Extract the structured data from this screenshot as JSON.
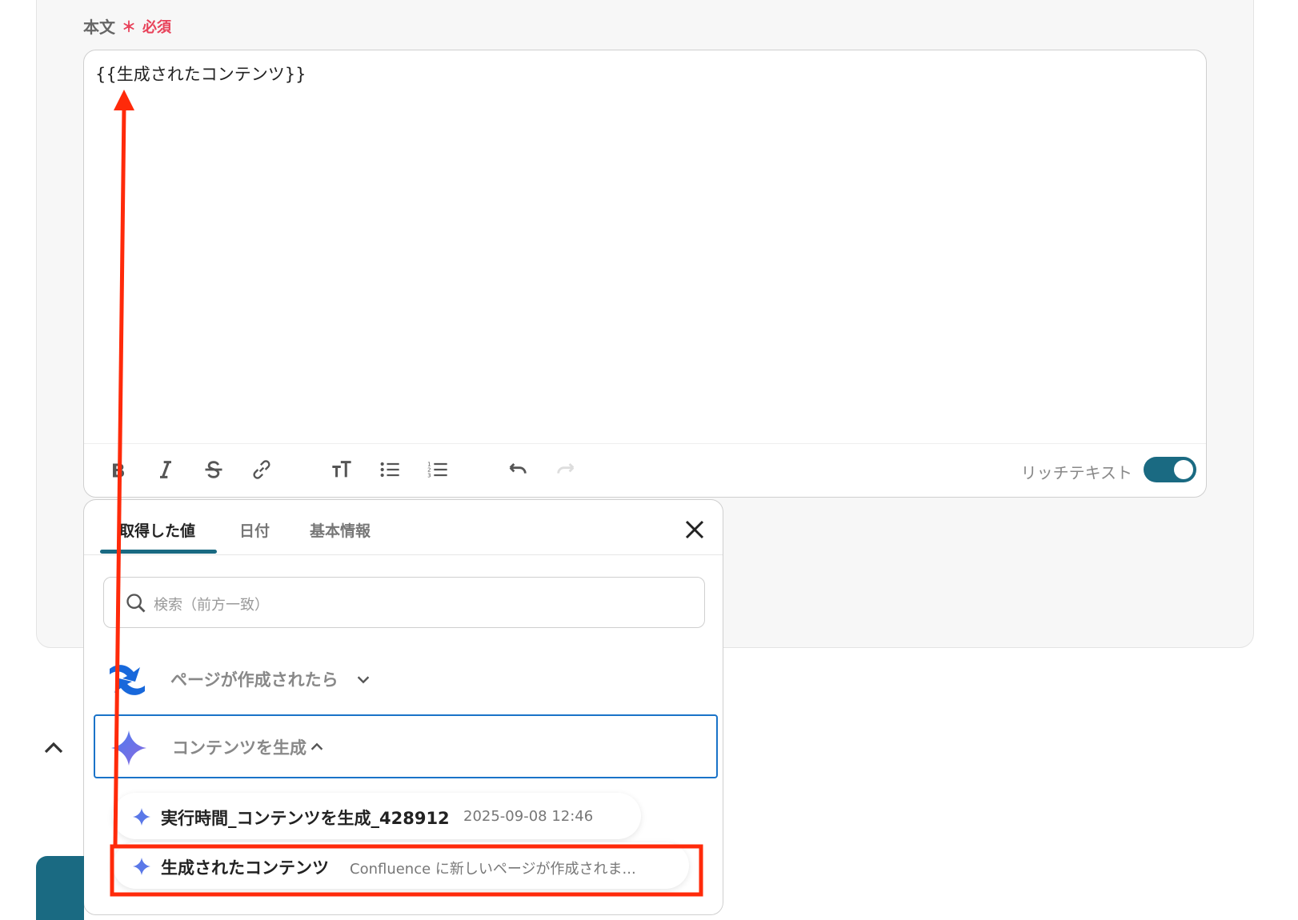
{
  "field": {
    "label": "本文",
    "required_mark": "＊",
    "required_text": "必須"
  },
  "editor": {
    "content": "{{生成されたコンテンツ}}"
  },
  "toolbar": {
    "buttons": [
      "bold-icon",
      "italic-icon",
      "strikethrough-icon",
      "link-icon",
      "text-size-icon",
      "bullet-list-icon",
      "numbered-list-icon",
      "undo-icon",
      "redo-icon"
    ],
    "rich_text_label": "リッチテキスト",
    "rich_text_enabled": true
  },
  "panel": {
    "tabs": [
      {
        "label": "取得した値",
        "active": true
      },
      {
        "label": "日付",
        "active": false
      },
      {
        "label": "基本情報",
        "active": false
      }
    ],
    "search_placeholder": "検索（前方一致）",
    "groups": [
      {
        "label": "ページが作成されたら",
        "expanded": false,
        "icon": "confluence-logo-icon"
      },
      {
        "label": "コンテンツを生成",
        "expanded": true,
        "icon": "ai-sparkle-icon"
      }
    ],
    "items": [
      {
        "name": "実行時間_コンテンツを生成_428912",
        "value": "2025-09-08 12:46"
      },
      {
        "name": "生成されたコンテンツ",
        "value": "Confluence に新しいページが作成されま..."
      }
    ]
  },
  "colors": {
    "accent": "#1a6a82",
    "required": "#e8425a",
    "annotation": "#ff2a0a",
    "selection": "#1a73c8"
  }
}
